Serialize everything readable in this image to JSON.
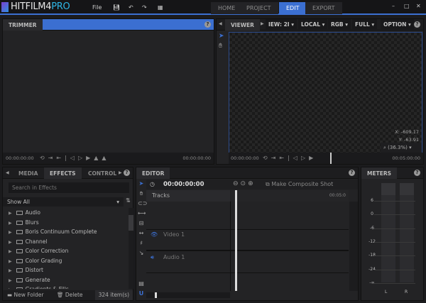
{
  "app": {
    "logo_main": "HITFILM4",
    "logo_pro": "PRO",
    "menu_file": "File"
  },
  "nav_tabs": [
    {
      "label": "HOME"
    },
    {
      "label": "PROJECT"
    },
    {
      "label": "EDIT",
      "active": true
    },
    {
      "label": "EXPORT"
    }
  ],
  "window_controls": {
    "minimize": "–",
    "maximize": "□",
    "close": "✕"
  },
  "trimmer": {
    "title": "TRIMMER",
    "time_left": "00:00:00:00",
    "time_right": "00:00:00:00"
  },
  "viewer": {
    "title": "VIEWER",
    "view_dd": "IEW: 2I",
    "space_dd": "LOCAL",
    "channel_dd": "RGB",
    "quality_dd": "FULL",
    "options_dd": "OPTION",
    "x_readout": "X:  -609.17",
    "y_readout": "Y:  -63.91",
    "zoom": "(36.3%)",
    "time_left": "00:00:00:00",
    "time_right": "00:05:00:00"
  },
  "effects": {
    "tabs": [
      "MEDIA",
      "EFFECTS",
      "CONTROL"
    ],
    "search_placeholder": "Search in Effects",
    "filter": "Show All",
    "items": [
      "Audio",
      "Blurs",
      "Boris Continuum Complete",
      "Channel",
      "Color Correction",
      "Color Grading",
      "Distort",
      "Generate",
      "Gradients & Fills"
    ],
    "new_folder": "New Folder",
    "delete": "Delete",
    "count": "324 item(s)"
  },
  "editor": {
    "title": "EDITOR",
    "timecode": "00:00:00:00",
    "make_composite": "Make Composite Shot",
    "tracks_label": "Tracks",
    "ruler_time": "00:05:0",
    "tracks": [
      {
        "name": "Video 1",
        "icon": "eye-icon"
      },
      {
        "name": "Audio 1",
        "icon": "speaker-icon"
      }
    ]
  },
  "meters": {
    "title": "METERS",
    "scale": [
      "6",
      "0",
      "-6",
      "-12",
      "-18",
      "-24",
      "-∞"
    ],
    "channels": [
      "L",
      "R"
    ]
  },
  "colors": {
    "accent": "#3b6fd1",
    "logo_pro": "#2fb6e6"
  }
}
